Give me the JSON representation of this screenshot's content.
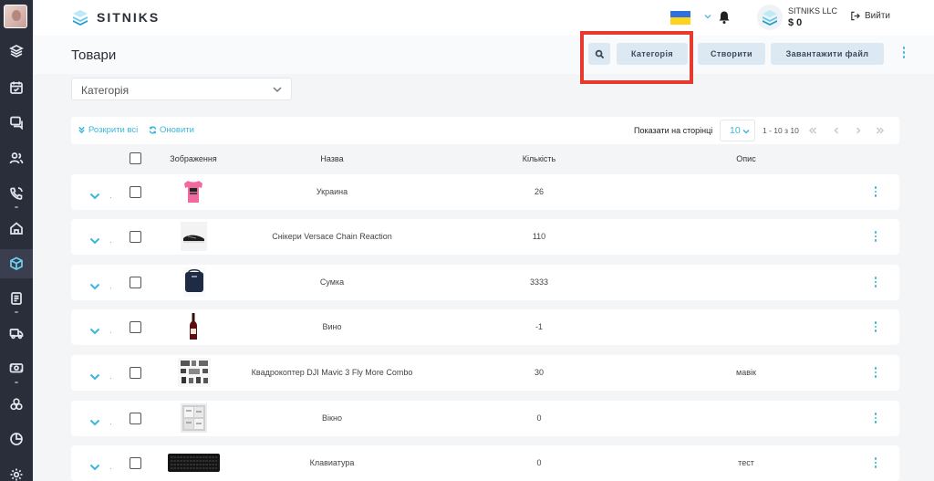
{
  "app": {
    "brand": "SITNIKS"
  },
  "header": {
    "company_name": "SITNIKS LLC",
    "balance": "$ 0",
    "logout_label": "Вийти"
  },
  "sidebar": {
    "items": [
      {
        "icon": "layers-icon"
      },
      {
        "icon": "calendar-icon"
      },
      {
        "icon": "chat-icon"
      },
      {
        "icon": "users-icon"
      },
      {
        "icon": "phone-icon"
      },
      {
        "icon": "home-icon"
      },
      {
        "icon": "products-icon",
        "active": true
      },
      {
        "icon": "orders-icon"
      },
      {
        "icon": "delivery-icon"
      },
      {
        "icon": "finance-icon"
      },
      {
        "icon": "integrations-icon"
      },
      {
        "icon": "reports-icon"
      },
      {
        "icon": "settings-icon"
      }
    ]
  },
  "page": {
    "title": "Товари",
    "buttons": {
      "category": "Категорія",
      "create": "Створити",
      "upload": "Завантажити файл"
    }
  },
  "filter": {
    "category_label": "Категорія"
  },
  "toolbar": {
    "expand_all": "Розкрити всі",
    "refresh": "Оновити",
    "per_page_label": "Показати на сторінці",
    "per_page_value": "10",
    "range": "1 - 10 з 10"
  },
  "table": {
    "headers": {
      "image": "Зображення",
      "name": "Назва",
      "quantity": "Кількість",
      "description": "Опис"
    },
    "rows": [
      {
        "name": "Украина",
        "quantity": "26",
        "description": "",
        "thumb": "tshirt"
      },
      {
        "name": "Снікери Versace Chain Reaction",
        "quantity": "110",
        "description": "",
        "thumb": "sneaker"
      },
      {
        "name": "Сумка",
        "quantity": "3333",
        "description": "",
        "thumb": "bag"
      },
      {
        "name": "Вино",
        "quantity": "-1",
        "description": "",
        "thumb": "wine"
      },
      {
        "name": "Квадрокоптер DJI Mavic 3 Fly More Combo",
        "quantity": "30",
        "description": "мавік",
        "thumb": "drone"
      },
      {
        "name": "Вікно",
        "quantity": "0",
        "description": "",
        "thumb": "window"
      },
      {
        "name": "Клавиатура",
        "quantity": "0",
        "description": "тест",
        "thumb": "keyboard"
      }
    ]
  },
  "colors": {
    "sidebar_bg": "#2a2d3a",
    "accent": "#3ab6dc",
    "button_bg": "#dde9f2",
    "highlight": "#e8392e"
  }
}
